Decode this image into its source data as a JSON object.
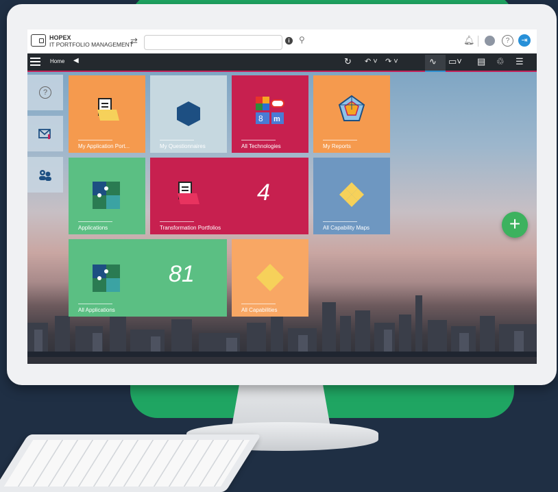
{
  "app": {
    "brand_line1": "HOPEX",
    "brand_line2": "IT PORTFOLIO MANAGEMENT"
  },
  "search": {
    "placeholder": ""
  },
  "nav": {
    "home_label": "Home"
  },
  "colors": {
    "accent_bar": "#c2225a",
    "tile_orange": "#f59a4e",
    "tile_light": "#c6d8e0",
    "tile_crimson": "#c7204f",
    "tile_green": "#5bbf83",
    "tile_blue": "#6e97c1",
    "fab_green": "#3cb25e"
  },
  "tiles": [
    {
      "label": "My Application Port...",
      "icon": "document-folder-icon"
    },
    {
      "label": "My Questionnaires",
      "icon": "hexagon-icon"
    },
    {
      "label": "All Technologies",
      "icon": "technology-grid-icon"
    },
    {
      "label": "My Reports",
      "icon": "radar-chart-icon"
    },
    {
      "label": "Applications",
      "icon": "puzzle-icon"
    },
    {
      "label": "Transformation Portfolios",
      "icon": "document-folder-icon",
      "count": "4"
    },
    {
      "label": "All Capability Maps",
      "icon": "diamond-grid-icon"
    },
    {
      "label": "All Applications",
      "icon": "puzzle-icon",
      "count": "81"
    },
    {
      "label": "All Capabilities",
      "icon": "diamond-icon"
    }
  ],
  "sidebar": [
    {
      "icon": "help-icon"
    },
    {
      "icon": "mail-icon"
    },
    {
      "icon": "users-settings-icon"
    }
  ]
}
